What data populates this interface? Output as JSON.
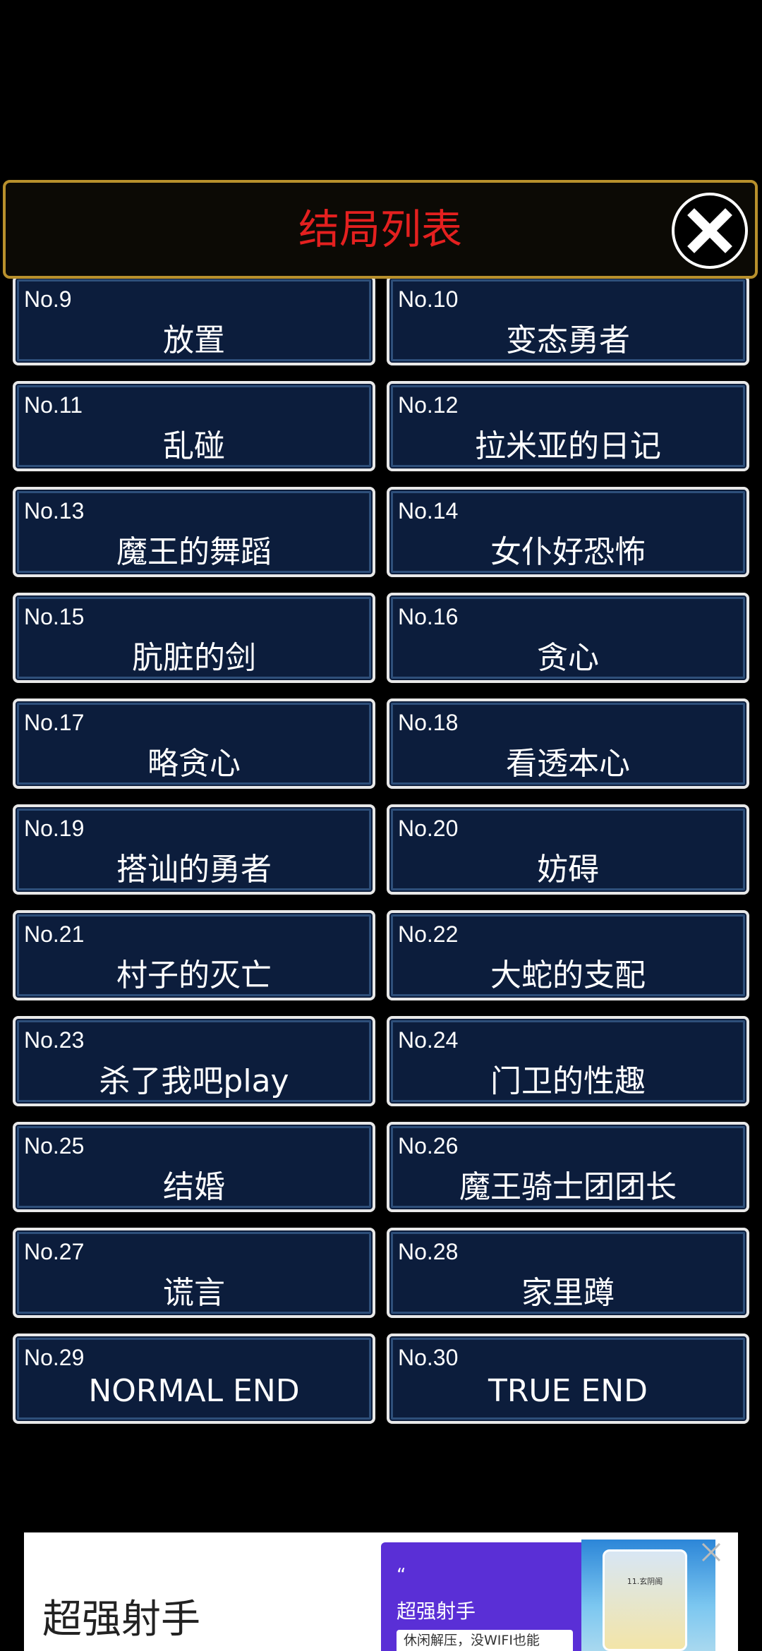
{
  "header": {
    "title": "结局列表"
  },
  "endings": [
    {
      "num": "No.9",
      "name": "放置"
    },
    {
      "num": "No.10",
      "name": "变态勇者"
    },
    {
      "num": "No.11",
      "name": "乱碰"
    },
    {
      "num": "No.12",
      "name": "拉米亚的日记"
    },
    {
      "num": "No.13",
      "name": "魔王的舞蹈"
    },
    {
      "num": "No.14",
      "name": "女仆好恐怖"
    },
    {
      "num": "No.15",
      "name": "肮脏的剑"
    },
    {
      "num": "No.16",
      "name": "贪心"
    },
    {
      "num": "No.17",
      "name": "略贪心"
    },
    {
      "num": "No.18",
      "name": "看透本心"
    },
    {
      "num": "No.19",
      "name": "搭讪的勇者"
    },
    {
      "num": "No.20",
      "name": "妨碍"
    },
    {
      "num": "No.21",
      "name": "村子的灭亡"
    },
    {
      "num": "No.22",
      "name": "大蛇的支配"
    },
    {
      "num": "No.23",
      "name": "杀了我吧play"
    },
    {
      "num": "No.24",
      "name": "门卫的性趣"
    },
    {
      "num": "No.25",
      "name": "结婚"
    },
    {
      "num": "No.26",
      "name": "魔王骑士团团长"
    },
    {
      "num": "No.27",
      "name": "谎言"
    },
    {
      "num": "No.28",
      "name": "家里蹲"
    },
    {
      "num": "No.29",
      "name": "NORMAL END"
    },
    {
      "num": "No.30",
      "name": "TRUE END"
    }
  ],
  "ad": {
    "title": "超强射手",
    "card_quote": "“",
    "card_title": "超强射手",
    "card_subtitle": "休闲解压，没WIFI也能",
    "game_level": "11.玄阴阁"
  },
  "colors": {
    "title_red": "#e4201f",
    "header_border": "#b8902c",
    "item_bg": "#0c1d3c",
    "ad_purple": "#5a2fd6"
  }
}
